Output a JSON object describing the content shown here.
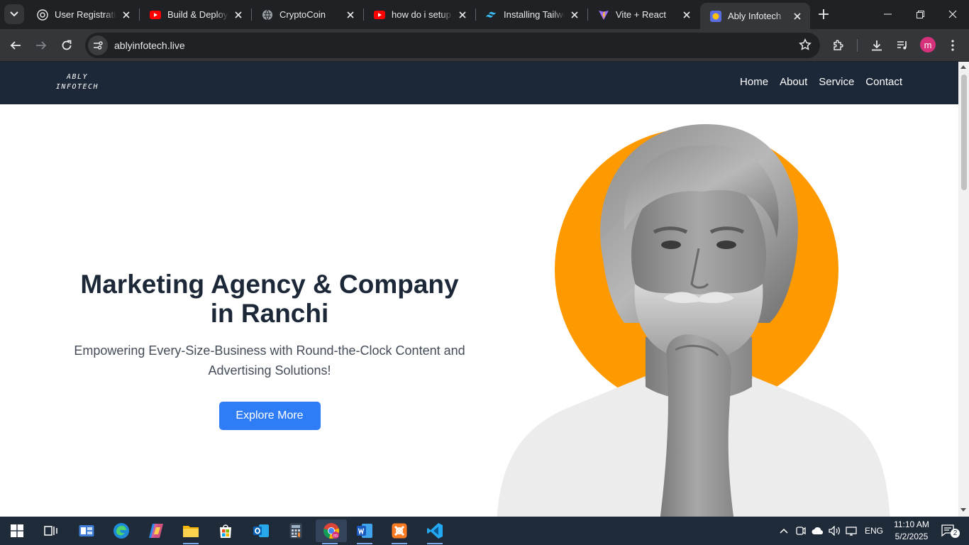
{
  "browser": {
    "tabs": [
      {
        "title": "User Registration",
        "favicon": "openai-icon",
        "active": false
      },
      {
        "title": "Build & Deploy A",
        "favicon": "youtube-icon",
        "active": false
      },
      {
        "title": "CryptoCoin",
        "favicon": "globe-icon",
        "active": false
      },
      {
        "title": "how do i setup F",
        "favicon": "youtube-icon",
        "active": false
      },
      {
        "title": "Installing Tailwin",
        "favicon": "tailwind-icon",
        "active": false
      },
      {
        "title": "Vite + React",
        "favicon": "vite-icon",
        "active": false
      },
      {
        "title": "Ably Infotech",
        "favicon": "ably-icon",
        "active": true
      }
    ],
    "address": "ablyinfotech.live",
    "profile_initial": "m"
  },
  "site": {
    "logo_line1": "ABLY",
    "logo_line2": "INFOTECH",
    "nav": [
      "Home",
      "About",
      "Service",
      "Contact"
    ],
    "hero": {
      "title": "Marketing Agency & Company in Ranchi",
      "subtitle": "Empowering Every-Size-Business with Round-the-Clock Content and Advertising Solutions!",
      "cta": "Explore More"
    },
    "colors": {
      "nav_bg": "#1c2838",
      "accent_orange": "#ff9900",
      "cta_blue": "#2f7df6"
    }
  },
  "taskbar": {
    "apps": [
      "start-icon",
      "task-view-icon",
      "widgets-icon",
      "edge-icon",
      "copilot-icon",
      "file-explorer-icon",
      "store-icon",
      "outlook-icon",
      "calculator-icon",
      "chrome-icon",
      "word-icon",
      "xampp-icon",
      "vscode-icon"
    ],
    "language": "ENG",
    "time": "11:10 AM",
    "date": "5/2/2025",
    "notification_count": "2"
  }
}
